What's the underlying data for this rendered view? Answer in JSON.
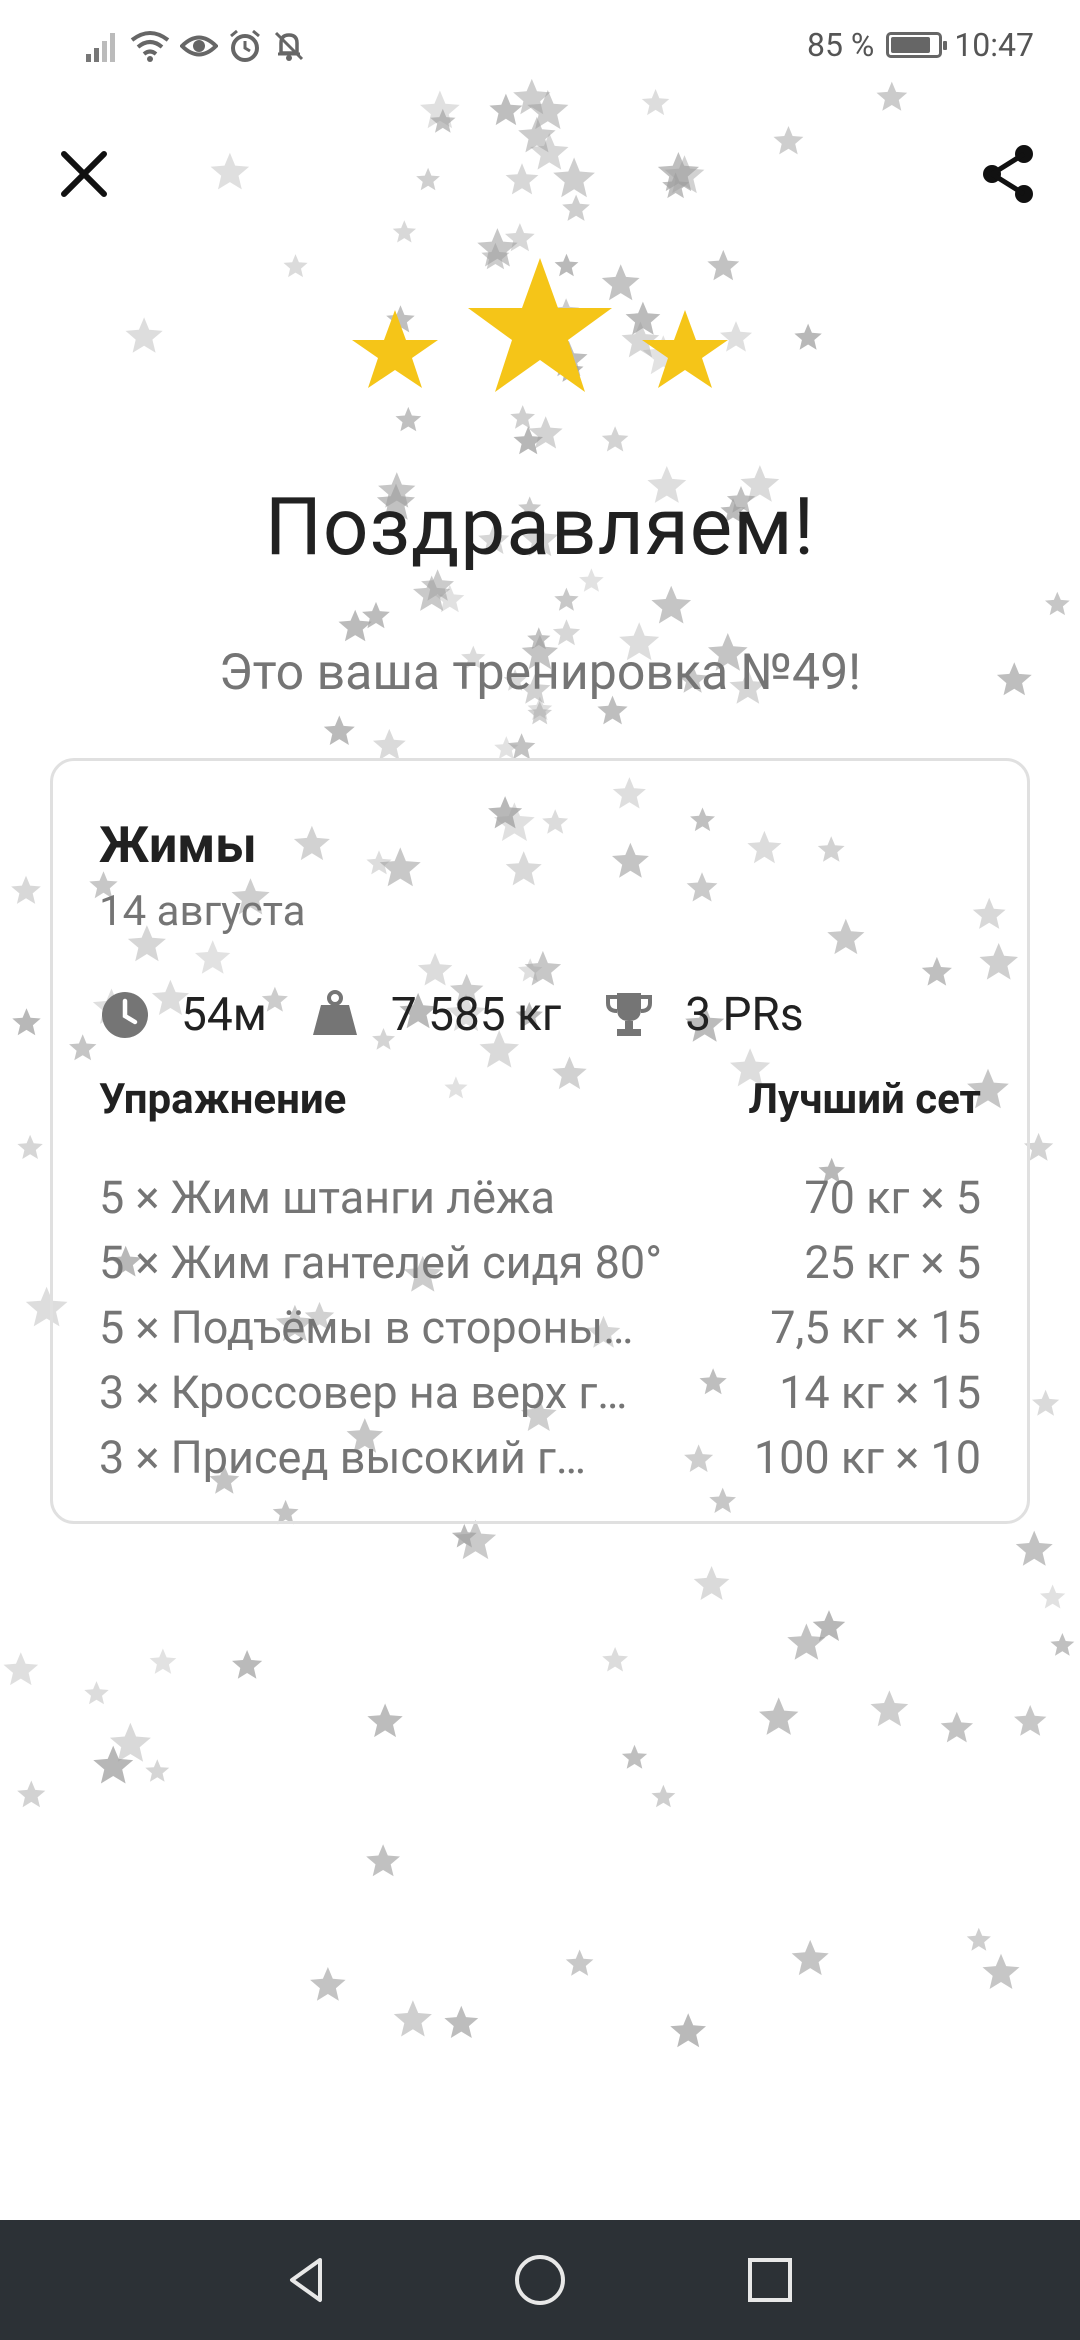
{
  "status_bar": {
    "battery_text": "85 %",
    "time": "10:47",
    "battery_level": 0.85
  },
  "header": {
    "headline": "Поздравляем!",
    "subtitle": "Это ваша тренировка №49!"
  },
  "card": {
    "title": "Жимы",
    "date": "14 августа",
    "stats": {
      "duration": "54м",
      "volume": "7 585 кг",
      "prs": "3 PRs"
    },
    "table_headers": {
      "exercise": "Упражнение",
      "best_set": "Лучший сет"
    },
    "rows": [
      {
        "exercise": "5 × Жим штанги лёжа",
        "best": "70 кг × 5"
      },
      {
        "exercise": "5 × Жим гантелей сидя 80°",
        "best": "25 кг × 5"
      },
      {
        "exercise": "5 × Подъёмы в стороны…",
        "best": "7,5 кг × 15"
      },
      {
        "exercise": "3 × Кроссовер на верх г…",
        "best": "14 кг × 15"
      },
      {
        "exercise": "3 × Присед высокий г…",
        "best": "100 кг × 10"
      }
    ]
  },
  "colors": {
    "gold": "#F5C518",
    "confetti": "#9e9e9e",
    "navbar": "#2c3136"
  },
  "icons": {
    "close": "close-icon",
    "share": "share-icon",
    "duration": "clock-icon",
    "volume": "weight-icon",
    "prs": "trophy-icon",
    "back": "back-icon",
    "home": "home-icon",
    "recents": "recents-icon"
  }
}
